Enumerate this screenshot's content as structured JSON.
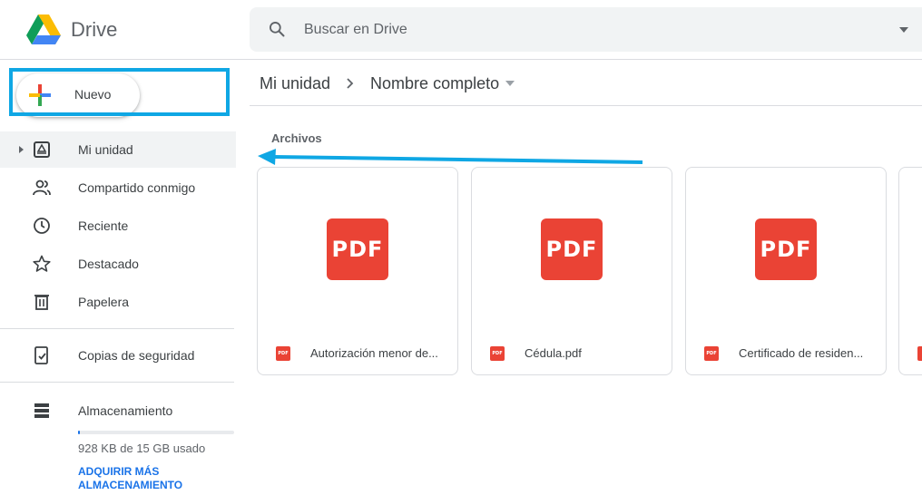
{
  "app": {
    "brand": "Drive"
  },
  "search": {
    "placeholder": "Buscar en Drive"
  },
  "sidebar": {
    "new_label": "Nuevo",
    "items": [
      {
        "label": "Mi unidad",
        "icon": "my-drive-icon",
        "active": true
      },
      {
        "label": "Compartido conmigo",
        "icon": "shared-icon"
      },
      {
        "label": "Reciente",
        "icon": "clock-icon"
      },
      {
        "label": "Destacado",
        "icon": "star-icon"
      },
      {
        "label": "Papelera",
        "icon": "trash-icon"
      }
    ],
    "backups": {
      "label": "Copias de seguridad",
      "icon": "backup-icon"
    },
    "storage": {
      "label": "Almacenamiento",
      "icon": "storage-icon",
      "usage_text": "928 KB de 15 GB usado",
      "used_fraction": 0.01,
      "buy_label": "ADQUIRIR MÁS ALMACENAMIENTO"
    }
  },
  "main": {
    "breadcrumb": [
      "Mi unidad",
      "Nombre completo"
    ],
    "section_title": "Archivos",
    "files": [
      {
        "name": "Autorización menor de...",
        "thumb_label": "PDF",
        "type_label": "PDF"
      },
      {
        "name": "Cédula.pdf",
        "thumb_label": "PDF",
        "type_label": "PDF"
      },
      {
        "name": "Certificado de residen...",
        "thumb_label": "PDF",
        "type_label": "PDF"
      }
    ]
  },
  "colors": {
    "highlight": "#0fa7e4",
    "pdf_red": "#ea4335",
    "link_blue": "#1a73e8"
  }
}
